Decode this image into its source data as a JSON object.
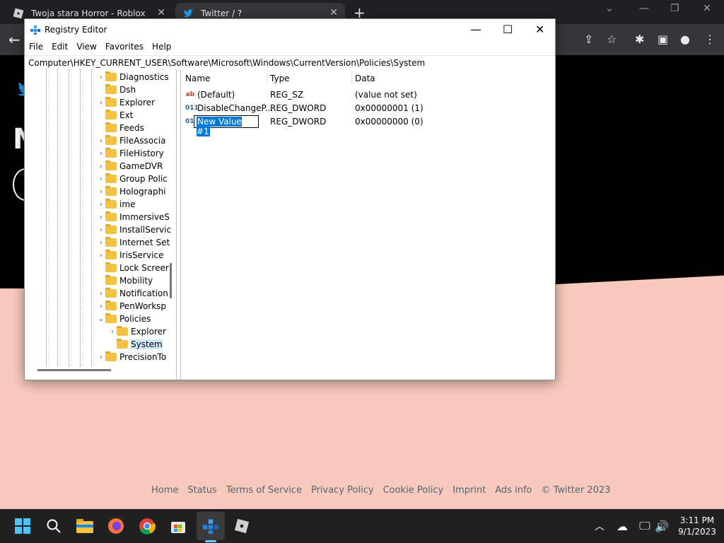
{
  "browser": {
    "tabs": [
      {
        "label": "Twoja stara Horror - Roblox"
      },
      {
        "label": "Twitter / ?"
      }
    ],
    "new_tab_glyph": "+",
    "close_glyph": "✕"
  },
  "twitter": {
    "big_letter": "N",
    "footer_links": [
      "Home",
      "Status",
      "Terms of Service",
      "Privacy Policy",
      "Cookie Policy",
      "Imprint",
      "Ads info",
      "© Twitter 2023"
    ]
  },
  "regedit": {
    "title": "Registry Editor",
    "menu": [
      "File",
      "Edit",
      "View",
      "Favorites",
      "Help"
    ],
    "address": "Computer\\HKEY_CURRENT_USER\\Software\\Microsoft\\Windows\\CurrentVersion\\Policies\\System",
    "tree": [
      {
        "label": "Diagnostics",
        "chev": ">",
        "depth": 0
      },
      {
        "label": "Dsh",
        "chev": "",
        "depth": 0
      },
      {
        "label": "Explorer",
        "chev": ">",
        "depth": 0
      },
      {
        "label": "Ext",
        "chev": "",
        "depth": 0
      },
      {
        "label": "Feeds",
        "chev": "",
        "depth": 0
      },
      {
        "label": "FileAssocia",
        "chev": ">",
        "depth": 0
      },
      {
        "label": "FileHistory",
        "chev": ">",
        "depth": 0
      },
      {
        "label": "GameDVR",
        "chev": ">",
        "depth": 0
      },
      {
        "label": "Group Polic",
        "chev": ">",
        "depth": 0
      },
      {
        "label": "Holographi",
        "chev": ">",
        "depth": 0
      },
      {
        "label": "ime",
        "chev": ">",
        "depth": 0
      },
      {
        "label": "ImmersiveS",
        "chev": ">",
        "depth": 0
      },
      {
        "label": "InstallServic",
        "chev": ">",
        "depth": 0
      },
      {
        "label": "Internet Set",
        "chev": ">",
        "depth": 0
      },
      {
        "label": "IrisService",
        "chev": ">",
        "depth": 0
      },
      {
        "label": "Lock Screer",
        "chev": "",
        "depth": 0
      },
      {
        "label": "Mobility",
        "chev": "",
        "depth": 0
      },
      {
        "label": "Notification",
        "chev": ">",
        "depth": 0
      },
      {
        "label": "PenWorksp",
        "chev": ">",
        "depth": 0
      },
      {
        "label": "Policies",
        "chev": "v",
        "depth": 0
      },
      {
        "label": "Explorer",
        "chev": ">",
        "depth": 1
      },
      {
        "label": "System",
        "chev": "",
        "depth": 1,
        "selected": true
      },
      {
        "label": "PrecisionTo",
        "chev": ">",
        "depth": 0
      }
    ],
    "columns": {
      "name": "Name",
      "type": "Type",
      "data": "Data"
    },
    "values": [
      {
        "icon": "ab",
        "name": "(Default)",
        "type": "REG_SZ",
        "data": "(value not set)"
      },
      {
        "icon": "011",
        "name": "DisableChangeP...",
        "type": "REG_DWORD",
        "data": "0x00000001 (1)"
      },
      {
        "icon": "011",
        "name": "New Value #1",
        "type": "REG_DWORD",
        "data": "0x00000000 (0)",
        "renaming": true
      }
    ]
  },
  "taskbar": {
    "time": "3:11 PM",
    "date": "9/1/2023"
  }
}
